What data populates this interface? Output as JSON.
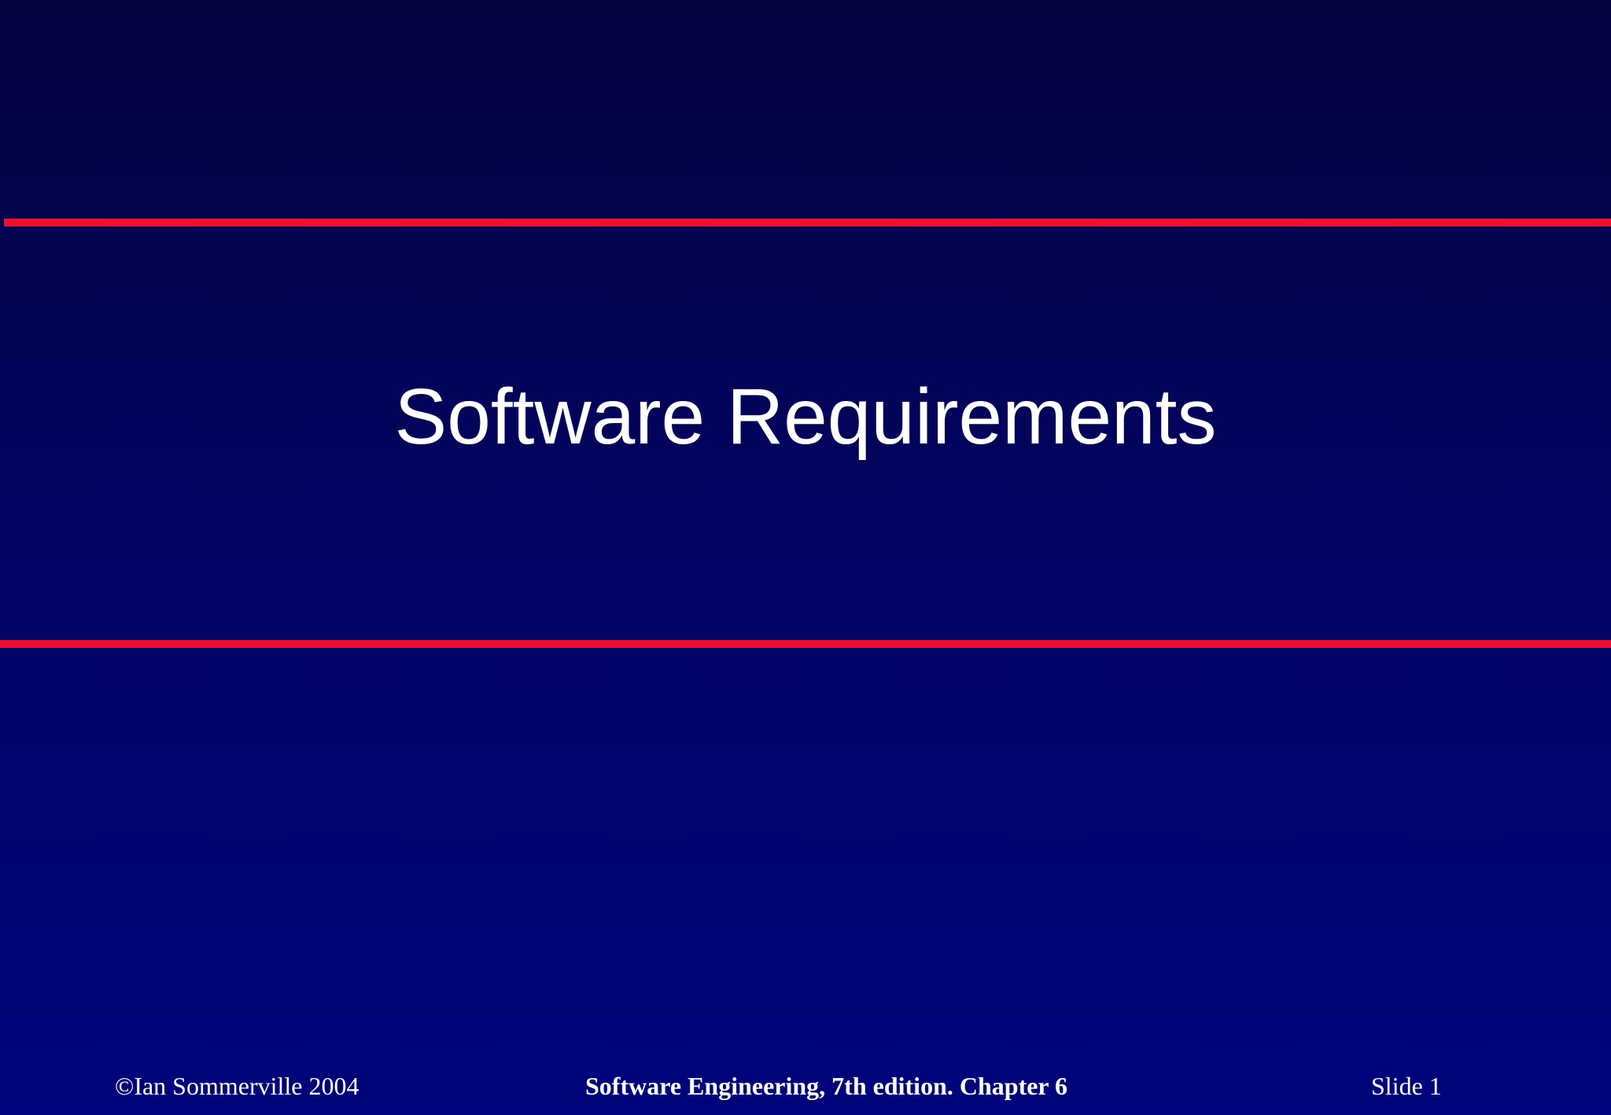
{
  "slide": {
    "title": "Software Requirements",
    "footer": {
      "copyright": "©Ian Sommerville 2004",
      "book": "Software Engineering, 7th edition. Chapter 6",
      "slide_number": "Slide  1"
    }
  },
  "colors": {
    "background_top": "#03033f",
    "background_bottom": "#00047c",
    "accent_rule": "#f00d2e",
    "text": "#ffffff"
  }
}
